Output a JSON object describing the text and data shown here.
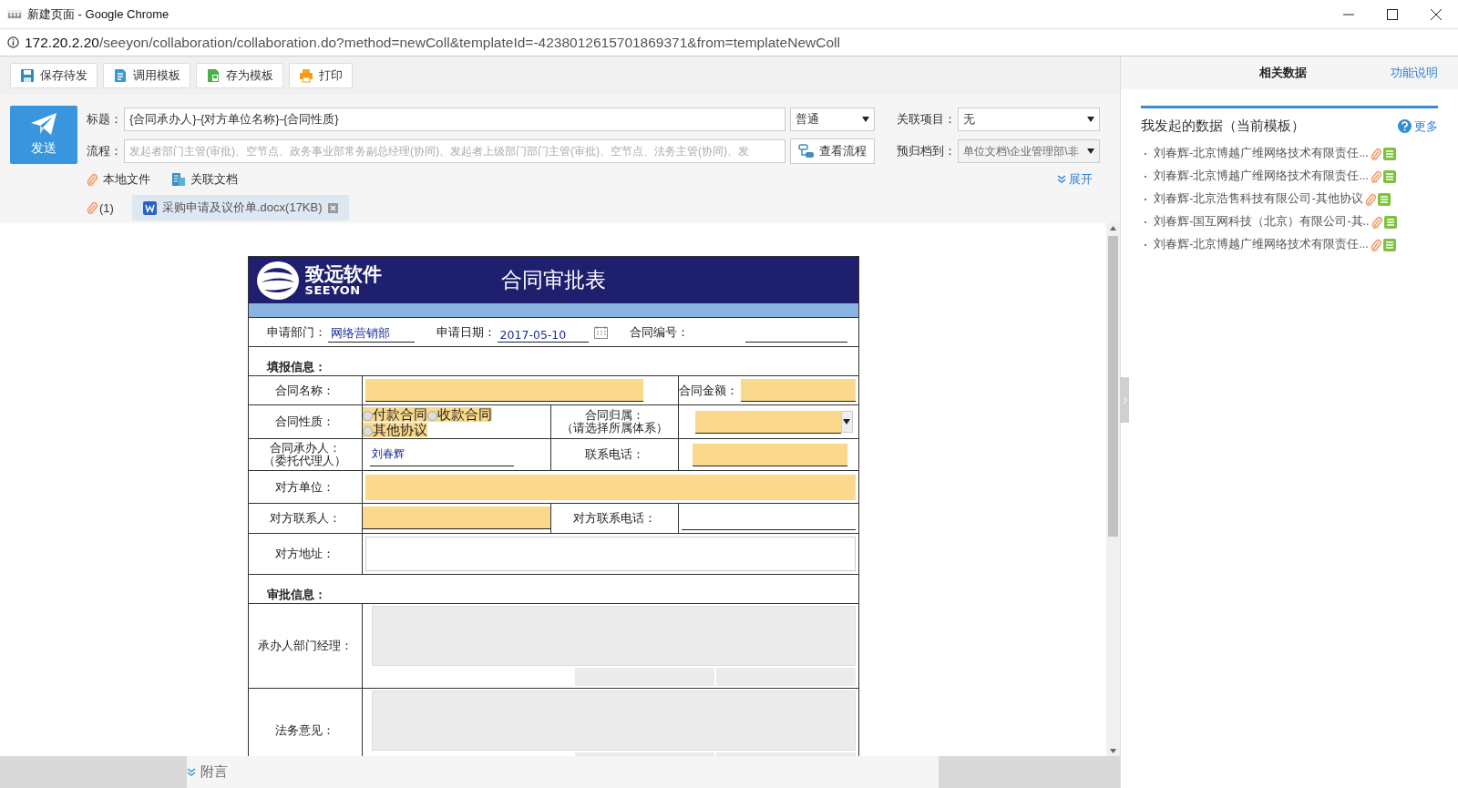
{
  "window": {
    "title": "新建页面 - Google Chrome"
  },
  "address_bar": {
    "host": "172.20.2.20",
    "path": "/seeyon/collaboration/collaboration.do?method=newColl&templateId=-4238012615701869371&from=templateNewColl"
  },
  "toolbar": [
    {
      "label": "保存待发"
    },
    {
      "label": "调用模板"
    },
    {
      "label": "存为模板"
    },
    {
      "label": "打印"
    }
  ],
  "send_button": {
    "label": "发送"
  },
  "header_fields": {
    "subject": {
      "label": "标题：",
      "value": "{合同承办人}-{对方单位名称}-{合同性质}"
    },
    "priority": {
      "value": "普通"
    },
    "workflow": {
      "label": "流程：",
      "placeholder": "发起者部门主管(审批)、空节点、政务事业部常务副总经理(协同)、发起者上级部门部门主管(审批)、空节点、法务主管(协同)、发"
    },
    "view_flow_button": {
      "label": "查看流程"
    },
    "related_project": {
      "label": "关联项目：",
      "value": "无"
    },
    "archive": {
      "label": "预归档到：",
      "value": "单位文档\\企业管理部\\非",
      "disabled": true
    }
  },
  "attachment_links": [
    {
      "label": "本地文件"
    },
    {
      "label": "关联文档"
    }
  ],
  "expand_link": {
    "label": "展开"
  },
  "attachments": {
    "count": "(1)",
    "files": [
      {
        "name": "采购申请及议价单.docx(17KB)"
      }
    ]
  },
  "side_panel": {
    "tabs": [
      {
        "label": "相关数据",
        "selected": true
      }
    ],
    "help_link": "功能说明",
    "section_title": "我发起的数据（当前模板）",
    "more_link": "更多",
    "items": [
      {
        "text": "刘春辉-北京博越广维网络技术有限责任..."
      },
      {
        "text": "刘春辉-北京博越广维网络技术有限责任..."
      },
      {
        "text": "刘春辉-北京浩售科技有限公司-其他协议"
      },
      {
        "text": "刘春辉-国互网科技（北京）有限公司-其.."
      },
      {
        "text": "刘春辉-北京博越广维网络技术有限责任..."
      }
    ]
  },
  "form": {
    "logo": {
      "cn": "致远软件",
      "en": "SEEYON"
    },
    "title": "合同审批表",
    "meta": [
      {
        "label": "申请部门：",
        "value": "网络营销部"
      },
      {
        "label": "申请日期：",
        "value": "2017-05-10",
        "kind": "date"
      },
      {
        "label": "合同编号："
      }
    ],
    "fill_section": "填报信息：",
    "contract_name": {
      "label": "合同名称：",
      "amount_label": "合同金额："
    },
    "contract_type": {
      "label": "合同性质：",
      "options": [
        {
          "label": "付款合同",
          "checked": false
        },
        {
          "label": "收款合同",
          "checked": false
        },
        {
          "label": "其他协议",
          "checked": false
        }
      ],
      "owner_label": "合同归属：",
      "owner_hint": "（请选择所属体系）"
    },
    "handler": {
      "label_lines": [
        "合同承办人：",
        "（委托代理人）"
      ],
      "value": "刘春辉",
      "phone_label": "联系电话："
    },
    "counterparty": {
      "label": "对方单位："
    },
    "counterparty_contact": {
      "label": "对方联系人：",
      "phone_label": "对方联系电话："
    },
    "counterparty_address": {
      "label": "对方地址："
    },
    "approval_section": "审批信息：",
    "approvals": [
      {
        "label": "承办人部门经理："
      },
      {
        "label": "法务意见："
      }
    ]
  },
  "footer": {
    "label": "附言"
  }
}
